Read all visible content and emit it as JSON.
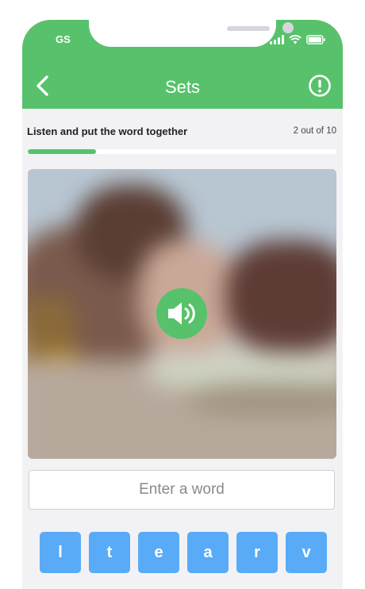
{
  "status_bar": {
    "carrier": "GS",
    "icons": [
      "signal-icon",
      "wifi-icon",
      "battery-icon"
    ]
  },
  "header": {
    "title": "Sets",
    "back_icon": "chevron-left-icon",
    "report_icon": "exclamation-circle-icon",
    "color": "#57c26b"
  },
  "exercise": {
    "instruction": "Listen and put the word together",
    "progress_text": "2 out of 10",
    "progress_fraction": 0.22,
    "play_icon": "speaker-icon"
  },
  "answer": {
    "placeholder": "Enter a word",
    "value": ""
  },
  "letters": [
    "l",
    "t",
    "e",
    "a",
    "r",
    "v"
  ],
  "colors": {
    "accent": "#57c26b",
    "tile": "#5aabf7",
    "background": "#f2f2f5"
  }
}
